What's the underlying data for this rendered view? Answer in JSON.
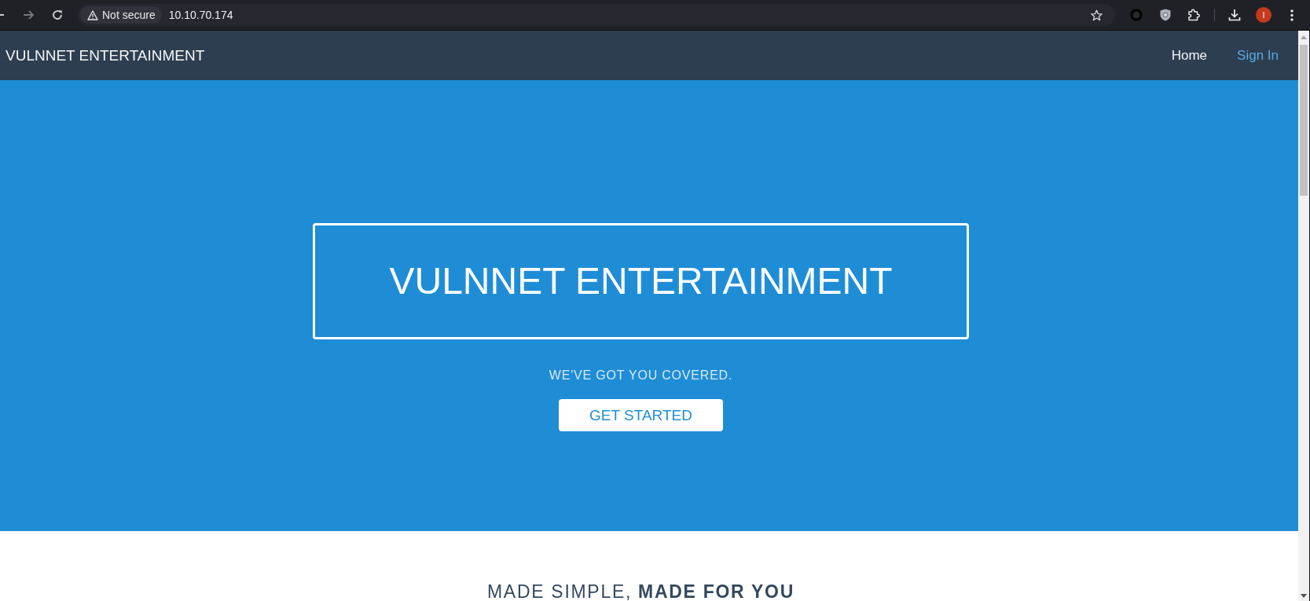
{
  "browser": {
    "forward_disabled": true,
    "security_label": "Not secure",
    "url": "10.10.70.174",
    "profile_initial": "I"
  },
  "navbar": {
    "brand": "VULNNET ENTERTAINMENT",
    "links": [
      {
        "label": "Home",
        "highlighted": false
      },
      {
        "label": "Sign In",
        "highlighted": true
      }
    ]
  },
  "hero": {
    "title": "VULNNET ENTERTAINMENT",
    "tagline": "WE'VE GOT YOU COVERED.",
    "button": "GET STARTED"
  },
  "section": {
    "heading": "MADE SIMPLE, **MADE FOR YOU**"
  }
}
